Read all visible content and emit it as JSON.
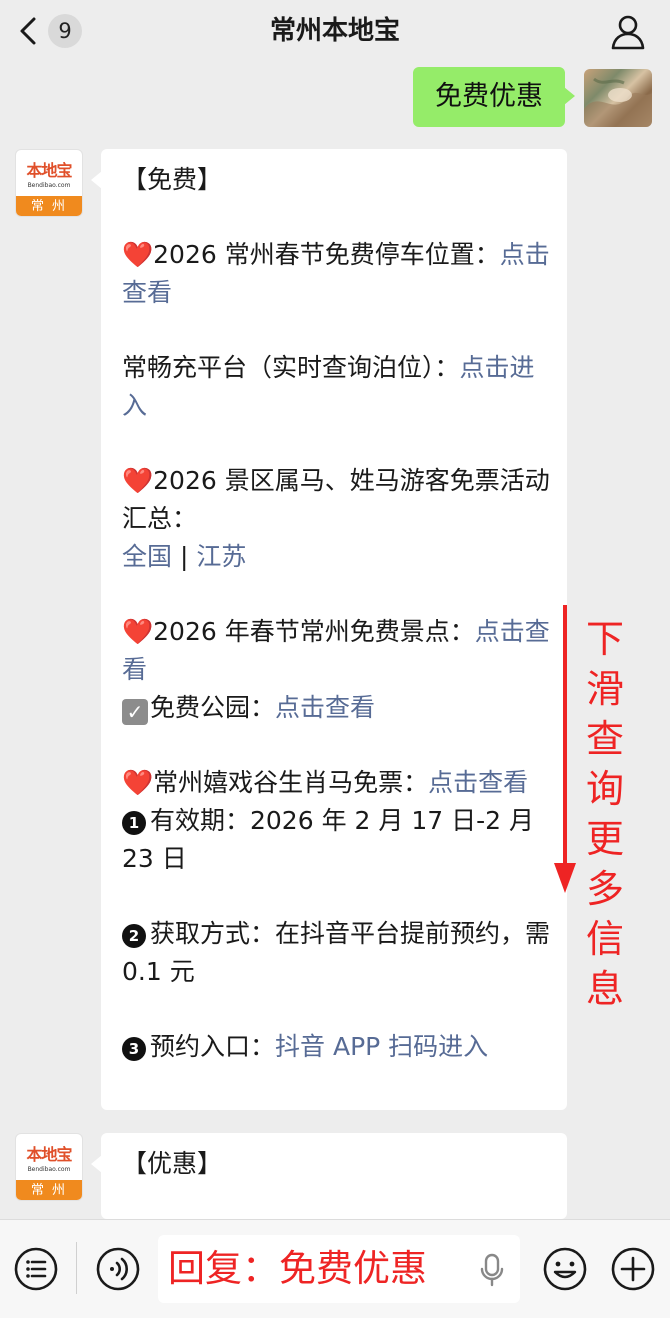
{
  "header": {
    "unread_count": "9",
    "title": "常州本地宝"
  },
  "chat": {
    "outgoing_message": "免费优惠",
    "bot_avatar": {
      "logo_text": "本地宝",
      "logo_sub": "Bendibao.com",
      "city": "常州"
    },
    "reply1": {
      "heading": "【免费】",
      "item1_text": "2026 常州春节免费停车位置：",
      "item1_link": "点击查看",
      "item2_text": "常畅充平台（实时查询泊位）：",
      "item2_link": "点击进入",
      "item3_text": "2026 景区属马、姓马游客免票活动汇总：",
      "item3_link_a": "全国",
      "item3_sep": " | ",
      "item3_link_b": "江苏",
      "item4_text": "2026 年春节常州免费景点：",
      "item4_link": "点击查看",
      "item5_text": "免费公园：",
      "item5_link": "点击查看",
      "item6_text": "常州嬉戏谷生肖马免票：",
      "item6_link": "点击查看",
      "detail1_num": "1",
      "detail1_text": "有效期：2026 年 2 月 17 日-2 月 23 日",
      "detail2_num": "2",
      "detail2_text": "获取方式：在抖音平台提前预约，需 0.1 元",
      "detail3_num": "3",
      "detail3_text": "预约入口：",
      "detail3_link": "抖音 APP 扫码进入"
    },
    "reply2": {
      "heading": "【优惠】"
    }
  },
  "overlay": {
    "scroll_hint": [
      "下",
      "滑",
      "查",
      "询",
      "更",
      "多",
      "信",
      "息"
    ],
    "color": "#ee2424"
  },
  "input_bar": {
    "value": "回复：免费优惠"
  },
  "colors": {
    "outgoing_bubble": "#95ec69",
    "link": "#576b95",
    "background": "#ededed",
    "annotation": "#ee2424"
  },
  "icons": [
    "back-chevron-icon",
    "profile-icon",
    "menu-list-icon",
    "voice-icon",
    "microphone-icon",
    "emoji-icon",
    "plus-icon",
    "heart-icon",
    "checkbox-icon"
  ]
}
